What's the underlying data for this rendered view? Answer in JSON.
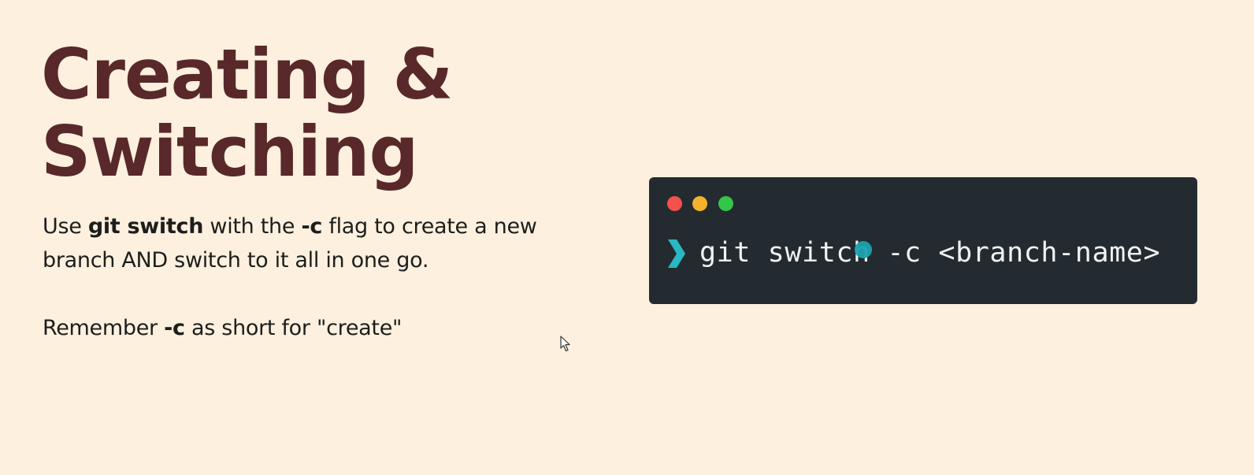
{
  "slide": {
    "title_line1": "Creating &",
    "title_line2": "Switching",
    "para1": {
      "t1": "Use ",
      "b1": "git switch",
      "t2": " with the ",
      "b2": "-c",
      "t3": " flag to create a new branch AND switch to it all in one go."
    },
    "para2": {
      "t1": "Remember ",
      "b1": "-c",
      "t2": " as short for \"create\""
    }
  },
  "terminal": {
    "command": "git switch -c <branch-name>",
    "prompt_icon": "chevron-right-icon",
    "window_controls": [
      "close",
      "minimize",
      "maximize"
    ]
  },
  "colors": {
    "background": "#fdf0de",
    "title": "#58282a",
    "terminal_bg": "#232b30",
    "prompt_accent": "#2ab7c4",
    "dot_red": "#f4504c",
    "dot_yellow": "#f2b22c",
    "dot_green": "#33c648"
  }
}
